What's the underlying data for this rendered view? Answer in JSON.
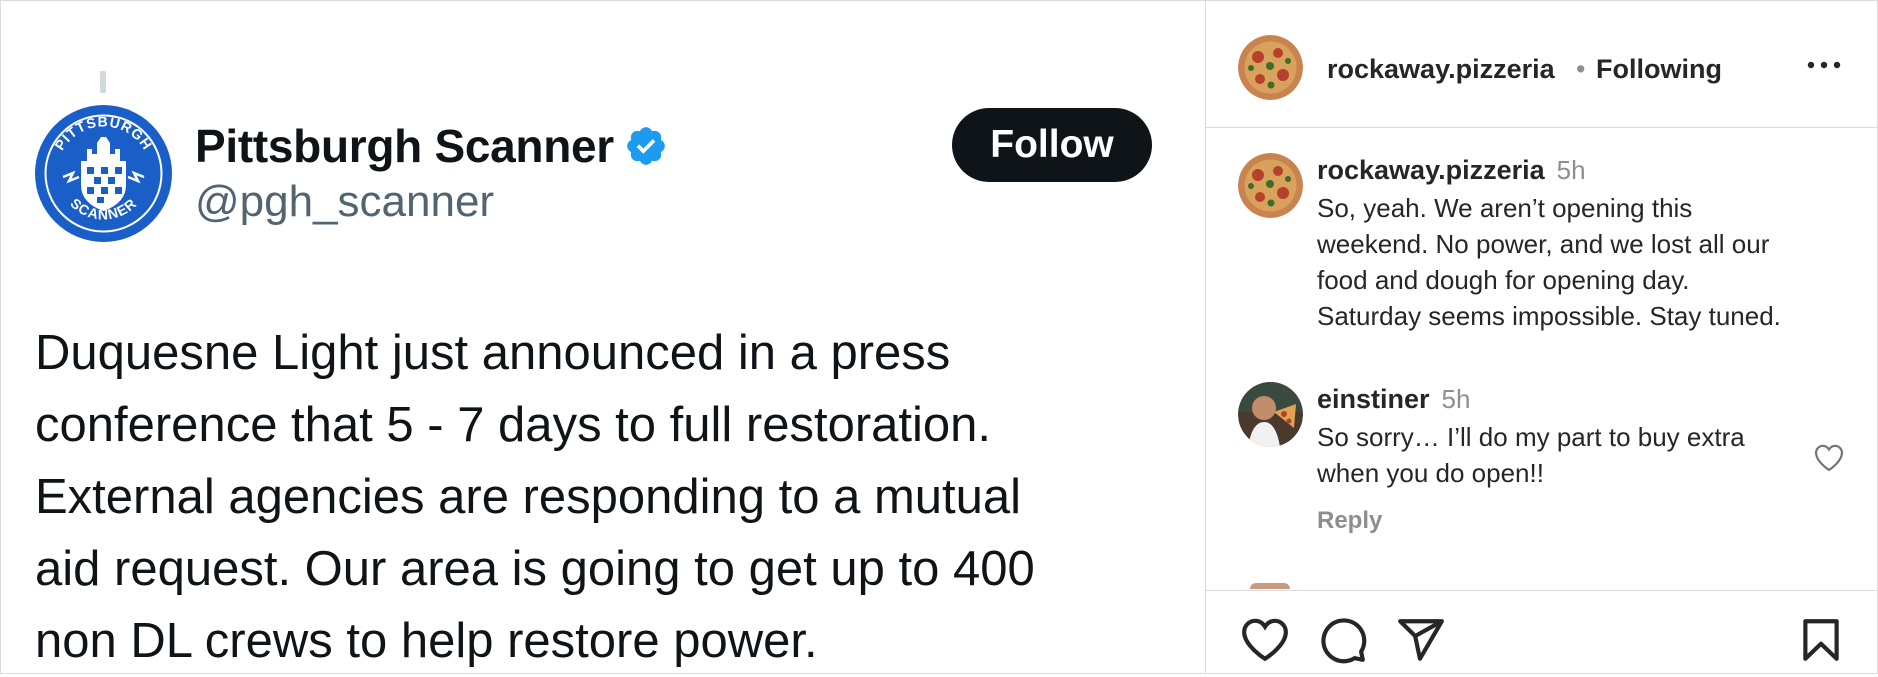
{
  "tweet": {
    "display_name": "Pittsburgh Scanner",
    "handle": "@pgh_scanner",
    "follow_label": "Follow",
    "avatar_text_top": "PITTSBURGH",
    "avatar_text_bottom": "SCANNER",
    "body_lines": [
      "Duquesne Light just announced in a press",
      "conference that 5 - 7 days to full restoration.",
      "External agencies are responding to a mutual",
      "aid request.  Our area is going to get up to 400",
      "non DL crews to help restore power."
    ],
    "colors": {
      "verified": "#1d9bf0",
      "avatar": "#1a5fc7",
      "follow_bg": "#0f1419"
    }
  },
  "post": {
    "header": {
      "username": "rockaway.pizzeria",
      "separator": "•",
      "following_label": "Following",
      "more_icon": "more-horizontal-icon"
    },
    "comments": [
      {
        "username": "rockaway.pizzeria",
        "time": "5h",
        "text_lines": [
          "So, yeah. We aren’t opening this",
          "weekend. No power, and we lost all our",
          "food and dough for opening day.",
          "Saturday seems impossible. Stay tuned."
        ]
      },
      {
        "username": "einstiner",
        "time": "5h",
        "text_lines": [
          "So sorry… I’ll do my part to buy extra",
          "when you do open!!"
        ],
        "reply_label": "Reply"
      }
    ],
    "actions": [
      "heart-icon",
      "comment-icon",
      "share-icon",
      "bookmark-icon"
    ]
  }
}
